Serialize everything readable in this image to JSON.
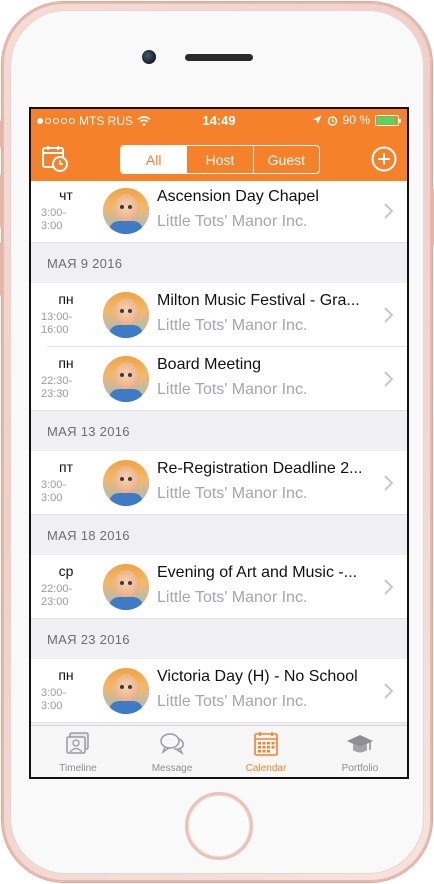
{
  "status_bar": {
    "carrier": "MTS RUS",
    "time": "14:49",
    "battery": "90 %",
    "battery_level": 0.9
  },
  "nav": {
    "segments": [
      "All",
      "Host",
      "Guest"
    ],
    "active_segment": "All"
  },
  "events": {
    "top_row": {
      "day": "чт",
      "time": "3:00-\n3:00",
      "title": "Ascension Day Chapel",
      "host": "Little Tots' Manor Inc."
    },
    "groups": [
      {
        "date": "МАЯ 9 2016",
        "rows": [
          {
            "day": "пн",
            "time": "13:00-\n16:00",
            "title": "Milton Music Festival - Gra...",
            "host": "Little Tots' Manor Inc."
          },
          {
            "day": "пн",
            "time": "22:30-\n23:30",
            "title": "Board Meeting",
            "host": "Little Tots' Manor Inc."
          }
        ]
      },
      {
        "date": "МАЯ 13 2016",
        "rows": [
          {
            "day": "пт",
            "time": "3:00-\n3:00",
            "title": "Re-Registration Deadline 2...",
            "host": "Little Tots' Manor Inc."
          }
        ]
      },
      {
        "date": "МАЯ 18 2016",
        "rows": [
          {
            "day": "ср",
            "time": "22:00-\n23:00",
            "title": "Evening of Art and Music -...",
            "host": "Little Tots' Manor Inc."
          }
        ]
      },
      {
        "date": "МАЯ 23 2016",
        "rows": [
          {
            "day": "пн",
            "time": "3:00-\n3:00",
            "title": "Victoria Day (H) - No School",
            "host": "Little Tots' Manor Inc."
          }
        ]
      }
    ]
  },
  "tabbar": {
    "tabs": [
      {
        "label": "Timeline",
        "icon": "photos-icon"
      },
      {
        "label": "Message",
        "icon": "chat-bubbles-icon"
      },
      {
        "label": "Calendar",
        "icon": "calendar-icon"
      },
      {
        "label": "Portfolio",
        "icon": "graduation-cap-icon"
      }
    ],
    "active": "Calendar"
  },
  "colors": {
    "accent": "#f5812a",
    "section_bg": "#efeff4",
    "secondary_text": "#a5a5aa"
  }
}
